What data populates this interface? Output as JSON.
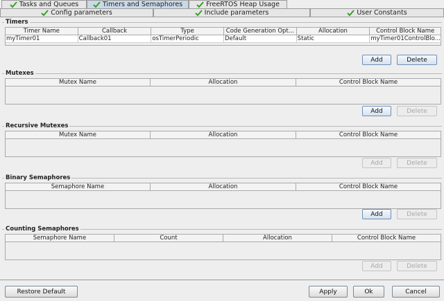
{
  "tabs_row1": [
    {
      "label": "Tasks and Queues",
      "selected": false
    },
    {
      "label": "Timers and Semaphores",
      "selected": true
    },
    {
      "label": "FreeRTOS Heap Usage",
      "selected": false
    }
  ],
  "tabs_row2": [
    {
      "label": "Config parameters"
    },
    {
      "label": "Include parameters"
    },
    {
      "label": "User Constants"
    }
  ],
  "timers": {
    "title": "Timers",
    "columns": [
      "Timer Name",
      "Callback",
      "Type",
      "Code Generation Opt...",
      "Allocation",
      "Control Block Name"
    ],
    "rows": [
      [
        "myTimer01",
        "Callback01",
        "osTimerPeriodic",
        "Default",
        "Static",
        "myTimer01ControlBlo..."
      ]
    ],
    "add_label": "Add",
    "delete_label": "Delete"
  },
  "mutexes": {
    "title": "Mutexes",
    "columns": [
      "Mutex Name",
      "Allocation",
      "Control Block Name"
    ],
    "add_label": "Add",
    "delete_label": "Delete"
  },
  "recursive_mutexes": {
    "title": "Recursive Mutexes",
    "columns": [
      "Mutex Name",
      "Allocation",
      "Control Block Name"
    ],
    "add_label": "Add",
    "delete_label": "Delete"
  },
  "binary_semaphores": {
    "title": "Binary Semaphores",
    "columns": [
      "Semaphore Name",
      "Allocation",
      "Control Block Name"
    ],
    "add_label": "Add",
    "delete_label": "Delete"
  },
  "counting_semaphores": {
    "title": "Counting Semaphores",
    "columns": [
      "Semaphore Name",
      "Count",
      "Allocation",
      "Control Block Name"
    ],
    "add_label": "Add",
    "delete_label": "Delete"
  },
  "footer": {
    "restore_label": "Restore Default",
    "apply_label": "Apply",
    "ok_label": "Ok",
    "cancel_label": "Cancel"
  },
  "colors": {
    "check": "#3aa028",
    "selected_tab": "#c9d9e9"
  }
}
